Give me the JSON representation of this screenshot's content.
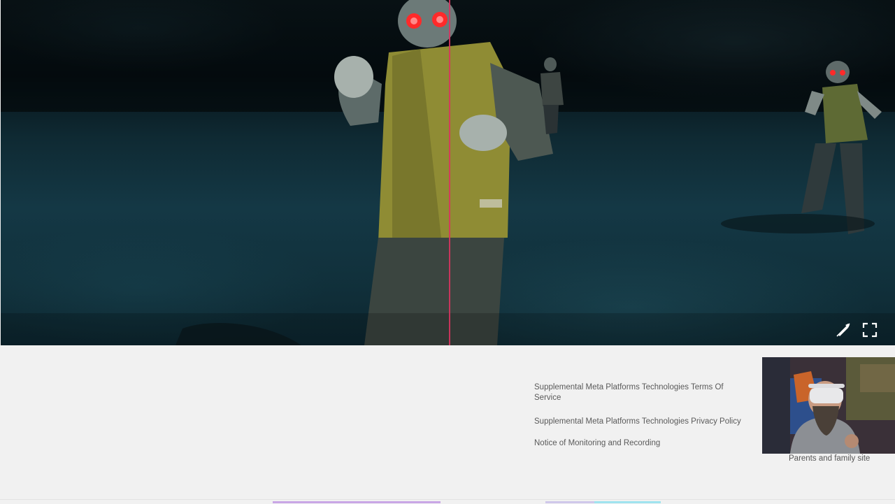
{
  "video_player": {
    "controls": {
      "mute_icon": "speaker-muted-icon",
      "fullscreen_icon": "fullscreen-icon"
    },
    "playhead_color": "#d8345f"
  },
  "footer": {
    "links": [
      {
        "label": "Supplemental Meta Platforms Technologies Terms Of Service"
      },
      {
        "label": "Supplemental Meta Platforms Technologies Privacy Policy"
      },
      {
        "label": "Notice of Monitoring and Recording"
      }
    ],
    "parents_link": "Parents and family site"
  },
  "colors": {
    "page_background": "#f1f1f1",
    "link_text": "#5a5a5a",
    "video_tint": "#143845"
  }
}
